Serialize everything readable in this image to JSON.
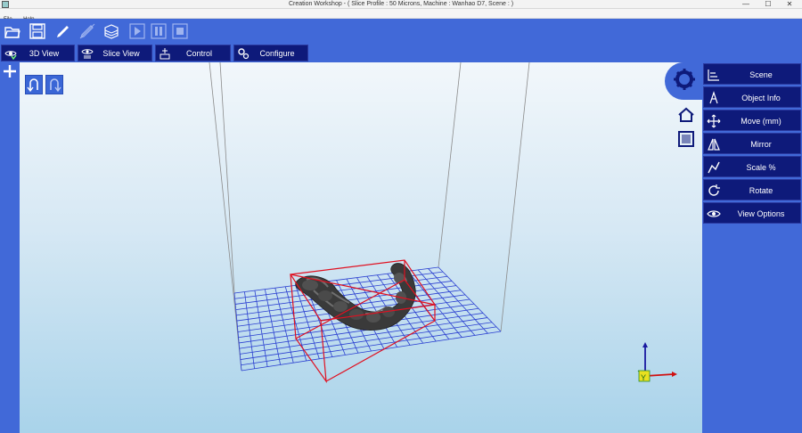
{
  "window": {
    "title": "Creation Workshop -   ( Slice Profile : 50 Microns, Machine : Wanhao D7, Scene : )",
    "controls": [
      "—",
      "☐",
      "✕"
    ]
  },
  "menu": {
    "items": [
      "File",
      "Help"
    ]
  },
  "toolbar": {
    "buttons": [
      "open-icon",
      "save-icon",
      "paint-icon",
      "slice-icon",
      "layers-icon",
      "play-icon",
      "pause-icon",
      "stop-icon"
    ]
  },
  "tabs": [
    {
      "label": "3D View",
      "icon": "eye-icon"
    },
    {
      "label": "Slice View",
      "icon": "eye-icon"
    },
    {
      "label": "Control",
      "icon": "printer-icon"
    },
    {
      "label": "Configure",
      "icon": "gears-icon"
    }
  ],
  "right_panel": {
    "items": [
      {
        "label": "Scene",
        "icon": "scene-icon"
      },
      {
        "label": "Object Info",
        "icon": "info-icon"
      },
      {
        "label": "Move (mm)",
        "icon": "move-icon"
      },
      {
        "label": "Mirror",
        "icon": "mirror-icon"
      },
      {
        "label": "Scale %",
        "icon": "scale-icon"
      },
      {
        "label": "Rotate",
        "icon": "rotate-icon"
      },
      {
        "label": "View Options",
        "icon": "eye-icon"
      }
    ]
  },
  "axis_labels": {
    "y": "Y"
  },
  "colors": {
    "chrome_blue": "#4169d8",
    "button_navy": "#0e1a7a",
    "grid_blue": "#2a3fd0",
    "bbox_red": "#e01020",
    "model_grey": "#3a3a3a"
  }
}
